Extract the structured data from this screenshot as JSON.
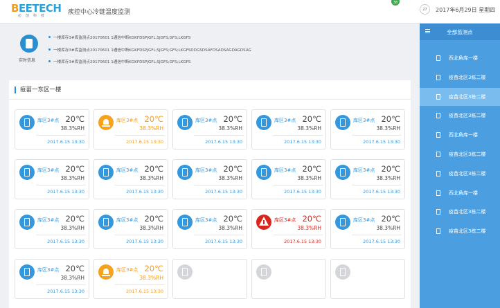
{
  "header": {
    "logo_text_b": "B",
    "logo_text_rest": "EETECH",
    "logo_subtext": "必创科技",
    "title": "疾控中心冷链温度监测",
    "notification_count": "38",
    "calendar_day": "27",
    "date": "2017年6月29日",
    "weekday": "星期四"
  },
  "info": {
    "label": "实时信息",
    "alerts": [
      "一楼库存3#库监测点20170601 1通信中断KGKFDSPJGFL;SJGFS;GFS;LKGFS",
      "一楼库存3#库监测点20170601 1通信中断KGKFDSPJGFL;SJGFS;GFS;LKGFSDDGSDSAFDSADSAGDAGDSAG",
      "一楼库存3#库监测点20170601 1通信中断KGKFDSPJGFL;SJGFS;GFS;LKGFS"
    ]
  },
  "panel": {
    "title": "疫苗一东区一楼"
  },
  "cards": [
    {
      "status": "normal",
      "name": "库区3#点",
      "temp": "20℃",
      "hum": "38.3%RH",
      "time": "2017.6.15   13:30"
    },
    {
      "status": "warn",
      "name": "库区3#点",
      "temp": "20℃",
      "hum": "38.3%RH",
      "time": "2017.6.15   13:30"
    },
    {
      "status": "normal",
      "name": "库区3#点",
      "temp": "20℃",
      "hum": "38.3%RH",
      "time": "2017.6.15   13:30"
    },
    {
      "status": "normal",
      "name": "库区3#点",
      "temp": "20℃",
      "hum": "38.3%RH",
      "time": "2017.6.15   13:30"
    },
    {
      "status": "normal",
      "name": "库区3#点",
      "temp": "20℃",
      "hum": "38.3%RH",
      "time": "2017.6.15   13:30"
    },
    {
      "status": "normal",
      "name": "库区3#点",
      "temp": "20℃",
      "hum": "38.3%RH",
      "time": "2017.6.15   13:30"
    },
    {
      "status": "normal",
      "name": "库区3#点",
      "temp": "20℃",
      "hum": "38.3%RH",
      "time": "2017.6.15   13:30"
    },
    {
      "status": "normal",
      "name": "库区3#点",
      "temp": "20℃",
      "hum": "38.3%RH",
      "time": "2017.6.15   13:30"
    },
    {
      "status": "normal",
      "name": "库区3#点",
      "temp": "20℃",
      "hum": "38.3%RH",
      "time": "2017.6.15   13:30"
    },
    {
      "status": "normal",
      "name": "库区3#点",
      "temp": "20℃",
      "hum": "38.3%RH",
      "time": "2017.6.15   13:30"
    },
    {
      "status": "normal",
      "name": "库区3#点",
      "temp": "20℃",
      "hum": "38.3%RH",
      "time": "2017.6.15   13:30"
    },
    {
      "status": "normal",
      "name": "库区3#点",
      "temp": "20℃",
      "hum": "38.3%RH",
      "time": "2017.6.15   13:30"
    },
    {
      "status": "normal",
      "name": "库区3#点",
      "temp": "20℃",
      "hum": "38.3%RH",
      "time": "2017.6.15   13:30"
    },
    {
      "status": "alarm",
      "name": "库区3#点",
      "temp": "20℃",
      "hum": "38.3%RH",
      "time": "2017.6.15   13:30"
    },
    {
      "status": "normal",
      "name": "库区3#点",
      "temp": "20℃",
      "hum": "38.3%RH",
      "time": "2017.6.15   13:30"
    },
    {
      "status": "normal",
      "name": "库区3#点",
      "temp": "20℃",
      "hum": "38.3%RH",
      "time": "2017.6.15   13:30"
    },
    {
      "status": "warn",
      "name": "库区3#点",
      "temp": "20℃",
      "hum": "38.3%RH",
      "time": "2017.6.15   13:30"
    },
    {
      "status": "offline",
      "name": "",
      "temp": "",
      "hum": "",
      "time": ""
    },
    {
      "status": "offline",
      "name": "",
      "temp": "",
      "hum": "",
      "time": ""
    },
    {
      "status": "offline",
      "name": "",
      "temp": "",
      "hum": "",
      "time": ""
    }
  ],
  "sidebar": {
    "title": "全部监测点",
    "items": [
      {
        "label": "西北角库一楼",
        "active": false
      },
      {
        "label": "疫苗北区3栋二楼",
        "active": false
      },
      {
        "label": "疫苗北区3栋二楼",
        "active": true
      },
      {
        "label": "疫苗北区3栋二楼",
        "active": false
      },
      {
        "label": "西北角库一楼",
        "active": false
      },
      {
        "label": "疫苗北区3栋二楼",
        "active": false
      },
      {
        "label": "疫苗北区3栋二楼",
        "active": false
      },
      {
        "label": "西北角库一楼",
        "active": false
      },
      {
        "label": "疫苗北区3栋二楼",
        "active": false
      },
      {
        "label": "疫苗北区3栋二楼",
        "active": false
      }
    ]
  },
  "colors": {
    "primary": "#3598dc",
    "warn": "#f39c1c",
    "alarm": "#d9261c",
    "sidebar": "#4b9fe0"
  }
}
